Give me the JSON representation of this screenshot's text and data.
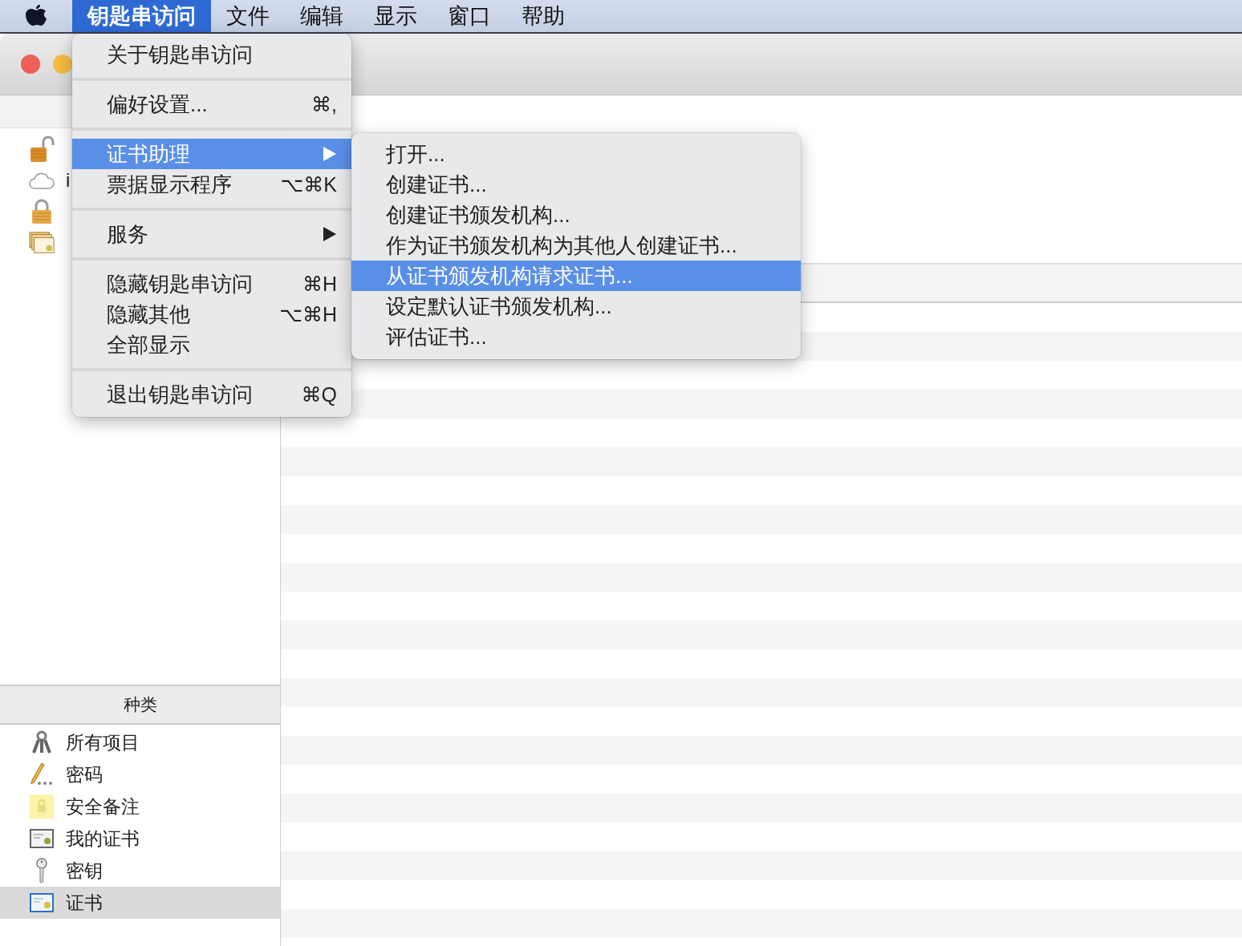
{
  "menu_bar": {
    "items": [
      {
        "label": "钥匙串访问",
        "selected": true
      },
      {
        "label": "文件",
        "selected": false
      },
      {
        "label": "编辑",
        "selected": false
      },
      {
        "label": "显示",
        "selected": false
      },
      {
        "label": "窗口",
        "selected": false
      },
      {
        "label": "帮助",
        "selected": false
      }
    ]
  },
  "app_menu": {
    "items": [
      {
        "kind": "item",
        "label": "关于钥匙串访问",
        "selected": false
      },
      {
        "kind": "separator"
      },
      {
        "kind": "item",
        "label": "偏好设置...",
        "shortcut": "⌘,",
        "selected": false
      },
      {
        "kind": "separator"
      },
      {
        "kind": "submenu",
        "label": "证书助理",
        "selected": true
      },
      {
        "kind": "item",
        "label": "票据显示程序",
        "shortcut": "⌥⌘K",
        "selected": false
      },
      {
        "kind": "separator"
      },
      {
        "kind": "submenu",
        "label": "服务",
        "selected": false
      },
      {
        "kind": "separator"
      },
      {
        "kind": "item",
        "label": "隐藏钥匙串访问",
        "shortcut": "⌘H",
        "selected": false
      },
      {
        "kind": "item",
        "label": "隐藏其他",
        "shortcut": "⌥⌘H",
        "selected": false
      },
      {
        "kind": "item",
        "label": "全部显示",
        "selected": false
      },
      {
        "kind": "separator"
      },
      {
        "kind": "item",
        "label": "退出钥匙串访问",
        "shortcut": "⌘Q",
        "selected": false
      }
    ]
  },
  "certificate_assistant_menu": {
    "items": [
      {
        "kind": "item",
        "label": "打开...",
        "selected": false
      },
      {
        "kind": "item",
        "label": "创建证书...",
        "selected": false
      },
      {
        "kind": "item",
        "label": "创建证书颁发机构...",
        "selected": false
      },
      {
        "kind": "item",
        "label": "作为证书颁发机构为其他人创建证书...",
        "selected": false
      },
      {
        "kind": "item",
        "label": "从证书颁发机构请求证书...",
        "selected": true
      },
      {
        "kind": "item",
        "label": "设定默认证书颁发机构...",
        "selected": false
      },
      {
        "kind": "item",
        "label": "评估证书...",
        "selected": false
      }
    ]
  },
  "keychains": [
    {
      "kind": "login"
    },
    {
      "kind": "icloud",
      "name": "i"
    },
    {
      "kind": "system"
    },
    {
      "kind": "roots"
    }
  ],
  "category": {
    "header": "种类",
    "items": [
      {
        "label": "所有项目",
        "selected": false
      },
      {
        "label": "密码",
        "selected": false
      },
      {
        "label": "安全备注",
        "selected": false
      },
      {
        "label": "我的证书",
        "selected": false
      },
      {
        "label": "密钥",
        "selected": false
      },
      {
        "label": "证书",
        "selected": true
      }
    ]
  }
}
